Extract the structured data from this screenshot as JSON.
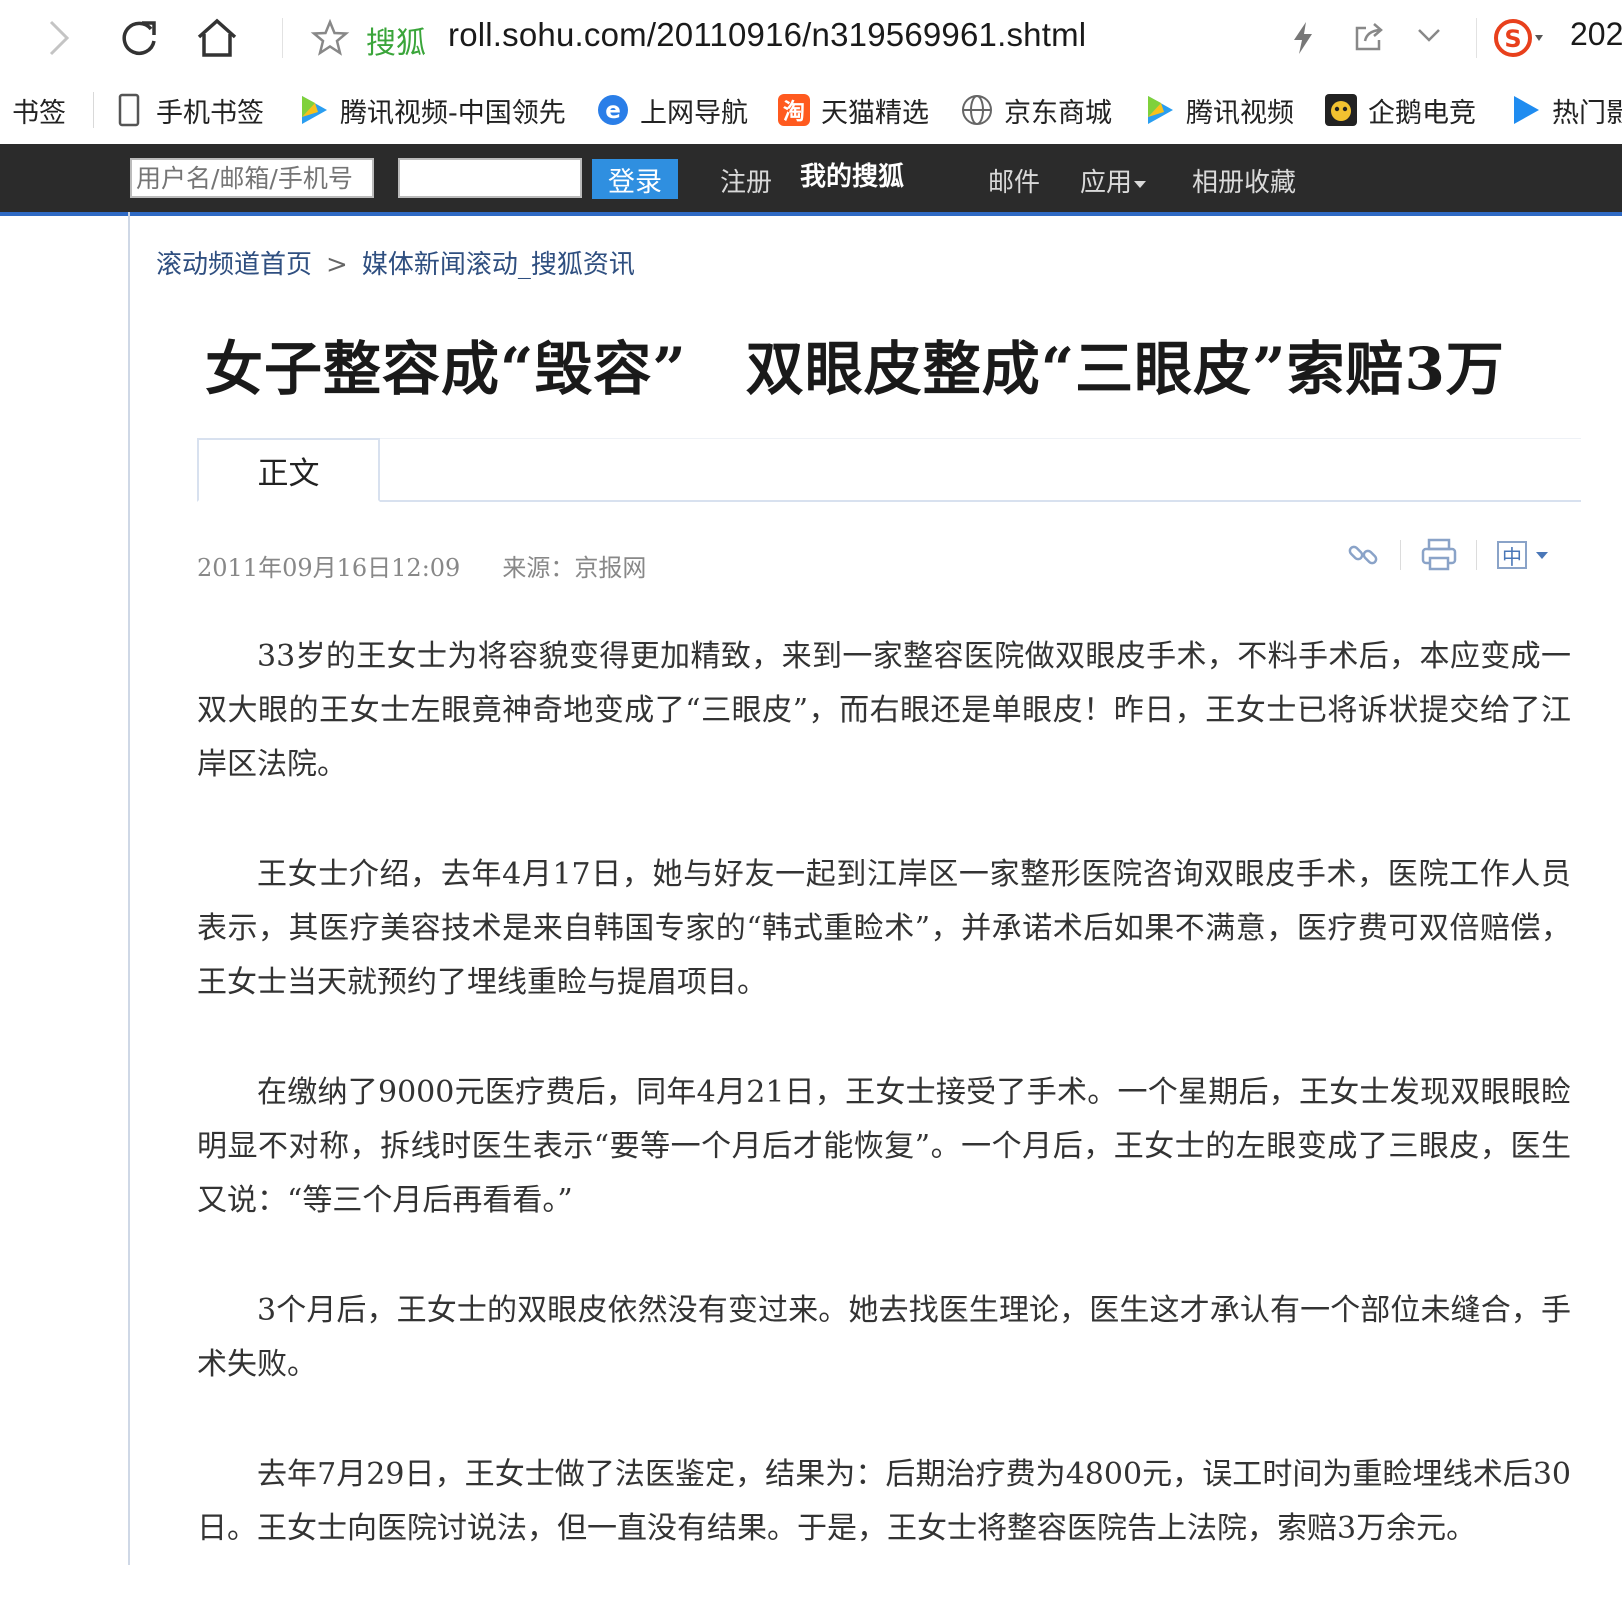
{
  "browser": {
    "site_label": "搜狐",
    "url": "roll.sohu.com/20110916/n319569961.shtml",
    "ext_text": "202",
    "icons": [
      "forward-icon",
      "refresh-icon",
      "home-icon",
      "star-icon",
      "lightning-icon",
      "share-icon",
      "chevron-down-icon",
      "sogou-icon"
    ]
  },
  "bookmarks": [
    {
      "label": "书签",
      "icon": "none"
    },
    {
      "label": "手机书签",
      "icon": "phone-icon"
    },
    {
      "label": "腾讯视频-中国领先",
      "icon": "tencent-video-icon"
    },
    {
      "label": "上网导航",
      "icon": "ie-icon"
    },
    {
      "label": "天猫精选",
      "icon": "tmall-icon"
    },
    {
      "label": "京东商城",
      "icon": "globe-icon"
    },
    {
      "label": "腾讯视频",
      "icon": "tencent-video-icon"
    },
    {
      "label": "企鹅电竞",
      "icon": "penguin-icon"
    },
    {
      "label": "热门影",
      "icon": "play-icon"
    }
  ],
  "sohu_bar": {
    "username_placeholder": "用户名/邮箱/手机号",
    "login_label": "登录",
    "register": "注册",
    "my_sohu": "我的搜狐",
    "mail": "邮件",
    "apps": "应用",
    "albums": "相册收藏"
  },
  "breadcrumb": {
    "home": "滚动频道首页",
    "separator": ">",
    "section": "媒体新闻滚动_搜狐资讯"
  },
  "article": {
    "title": "女子整容成“毁容”　双眼皮整成“三眼皮”索赔3万",
    "tab": "正文",
    "date": "2011年09月16日12:09",
    "source": "来源：京报网",
    "paragraphs": [
      "33岁的王女士为将容貌变得更加精致，来到一家整容医院做双眼皮手术，不料手术后，本应变成一双大眼的王女士左眼竟神奇地变成了“三眼皮”，而右眼还是单眼皮！昨日，王女士已将诉状提交给了江岸区法院。",
      "王女士介绍，去年4月17日，她与好友一起到江岸区一家整形医院咨询双眼皮手术，医院工作人员表示，其医疗美容技术是来自韩国专家的“韩式重睑术”，并承诺术后如果不满意，医疗费可双倍赔偿，王女士当天就预约了埋线重睑与提眉项目。",
      "在缴纳了9000元医疗费后，同年4月21日，王女士接受了手术。一个星期后，王女士发现双眼眼睑明显不对称，拆线时医生表示“要等一个月后才能恢复”。一个月后，王女士的左眼变成了三眼皮，医生又说：“等三个月后再看看。”",
      "3个月后，王女士的双眼皮依然没有变过来。她去找医生理论，医生这才承认有一个部位未缝合，手术失败。",
      "去年7月29日，王女士做了法医鉴定，结果为：后期治疗费为4800元，误工时间为重睑埋线术后30日。王女士向医院讨说法，但一直没有结果。于是，王女士将整容医院告上法院，索赔3万余元。"
    ]
  },
  "tools": {
    "icons": [
      "link-icon",
      "print-icon",
      "font-size-icon"
    ],
    "font_size_glyph": "中"
  },
  "colors": {
    "sohu_bar_bg": "#2b2b2b",
    "login_button": "#2f8fe0",
    "breadcrumb_link": "#2f4f80",
    "site_badge": "#3aa53a"
  }
}
